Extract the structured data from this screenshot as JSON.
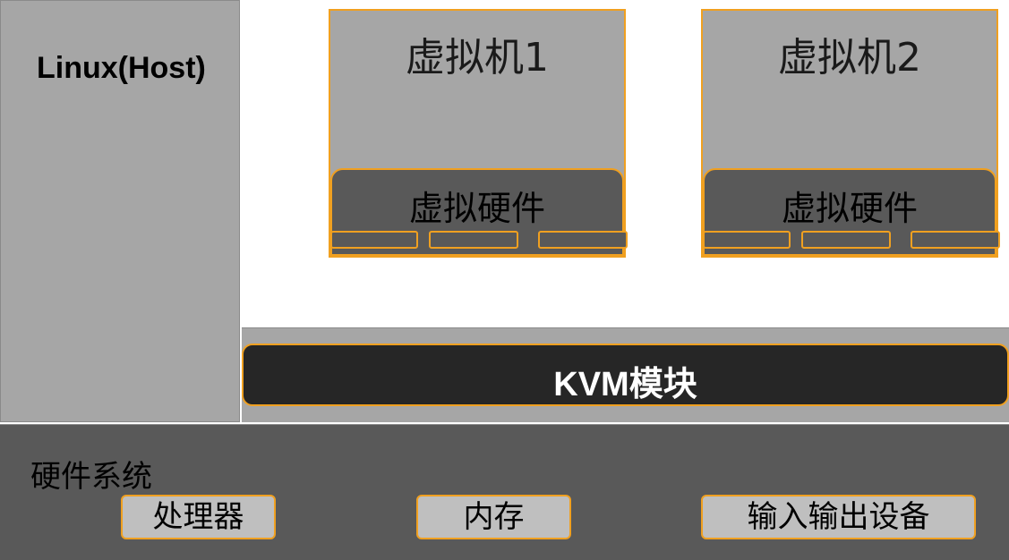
{
  "host": {
    "title": "Linux(Host)"
  },
  "vms": [
    {
      "title": "虚拟机1",
      "hardware_label": "虚拟硬件"
    },
    {
      "title": "虚拟机2",
      "hardware_label": "虚拟硬件"
    }
  ],
  "kvm": {
    "label": "KVM模块"
  },
  "hardware": {
    "title": "硬件系统",
    "items": [
      {
        "label": "处理器"
      },
      {
        "label": "内存"
      },
      {
        "label": "输入输出设备"
      }
    ]
  },
  "colors": {
    "accent_border": "#f0a020",
    "light_gray": "#a6a6a6",
    "dark_gray": "#595959",
    "kvm_fill": "#262626",
    "item_fill": "#bfbfbf"
  }
}
